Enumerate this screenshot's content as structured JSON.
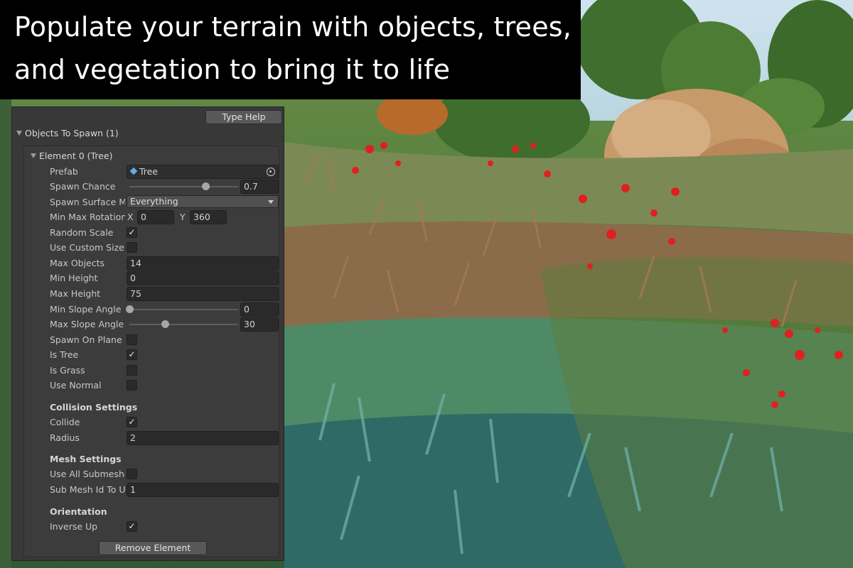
{
  "caption": {
    "line1": "Populate your terrain with objects, trees,",
    "line2": "and vegetation to bring it to life"
  },
  "panel": {
    "type_help_button": "Type Help",
    "objects_foldout": "Objects To Spawn (1)",
    "element_foldout": "Element 0 (Tree)",
    "remove_button": "Remove Element",
    "fields": {
      "prefab": {
        "label": "Prefab",
        "value": "Tree",
        "icon": "prefab-cube-icon"
      },
      "spawn_chance": {
        "label": "Spawn Chance",
        "value": "0.7",
        "fraction": 0.7
      },
      "spawn_surface": {
        "label": "Spawn Surface M",
        "value": "Everything"
      },
      "rotation": {
        "label": "Min Max Rotation",
        "x_label": "X",
        "x_value": "0",
        "y_label": "Y",
        "y_value": "360"
      },
      "random_scale": {
        "label": "Random Scale",
        "checked": true
      },
      "use_custom_size": {
        "label": "Use Custom Size",
        "checked": false
      },
      "max_objects": {
        "label": "Max Objects",
        "value": "14"
      },
      "min_height": {
        "label": "Min Height",
        "value": "0"
      },
      "max_height": {
        "label": "Max Height",
        "value": "75"
      },
      "min_slope": {
        "label": "Min Slope Angle",
        "value": "0",
        "fraction": 0.0
      },
      "max_slope": {
        "label": "Max Slope Angle",
        "value": "30",
        "fraction": 0.33
      },
      "spawn_on_plane": {
        "label": "Spawn On Plane",
        "checked": false
      },
      "is_tree": {
        "label": "Is Tree",
        "checked": true
      },
      "is_grass": {
        "label": "Is Grass",
        "checked": false
      },
      "use_normal": {
        "label": "Use Normal",
        "checked": false
      }
    },
    "collision": {
      "header": "Collision Settings",
      "collide": {
        "label": "Collide",
        "checked": true
      },
      "radius": {
        "label": "Radius",
        "value": "2"
      }
    },
    "mesh": {
      "header": "Mesh Settings",
      "use_all_submeshes": {
        "label": "Use All Submeshe",
        "checked": false
      },
      "sub_mesh_id": {
        "label": "Sub Mesh Id To U",
        "value": "1"
      }
    },
    "orientation": {
      "header": "Orientation",
      "inverse_up": {
        "label": "Inverse Up",
        "checked": true
      }
    }
  },
  "check_glyph": "✓"
}
